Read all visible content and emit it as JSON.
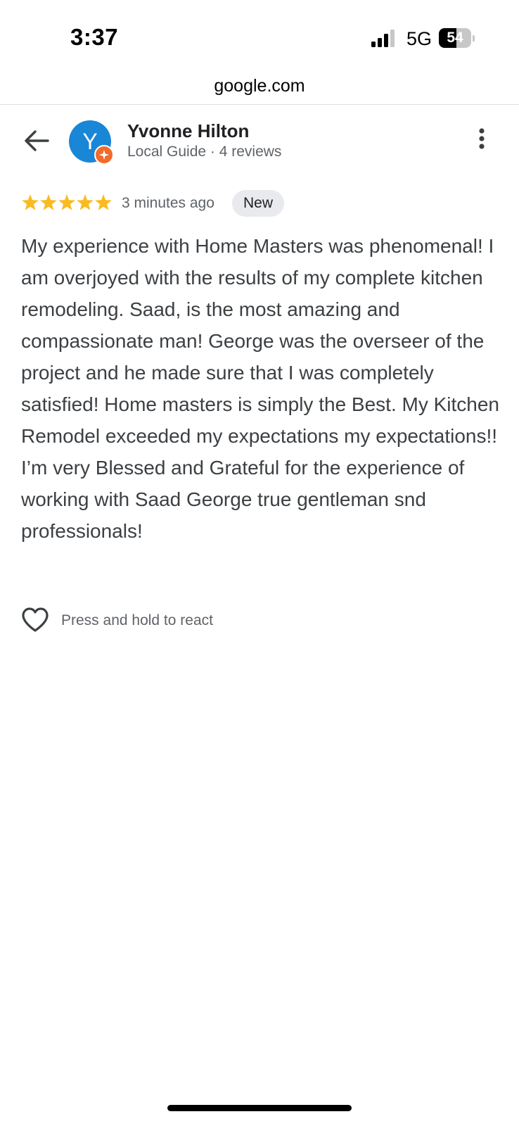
{
  "status_bar": {
    "time": "3:37",
    "network": "5G",
    "battery_level": "54",
    "battery_fraction": 0.54,
    "icons": [
      "signal-icon",
      "battery-icon"
    ]
  },
  "browser": {
    "url": "google.com"
  },
  "reviewer": {
    "avatar_initial": "Y",
    "avatar_color": "#1a86d6",
    "badge_color": "#f16b2a",
    "name": "Yvonne Hilton",
    "meta": "Local Guide · 4 reviews"
  },
  "review": {
    "rating": 5,
    "rating_max": 5,
    "star_color": "#f9bb1f",
    "time_ago": "3 minutes ago",
    "badge": "New",
    "text": "My experience with Home Masters was phenomenal! I am overjoyed with the results of my complete kitchen remodeling. Saad, is the most amazing and compassionate man! George was the overseer of the project and he made sure that I was completely satisfied! Home masters is simply the Best. My Kitchen Remodel exceeded my expectations my expectations!! I’m very Blessed and Grateful for the experience of working with Saad George true gentleman snd professionals!"
  },
  "react": {
    "label": "Press and hold to react",
    "icon": "heart-outline-icon"
  },
  "header_icons": {
    "back": "arrow-back-icon",
    "more": "more-vertical-icon"
  }
}
